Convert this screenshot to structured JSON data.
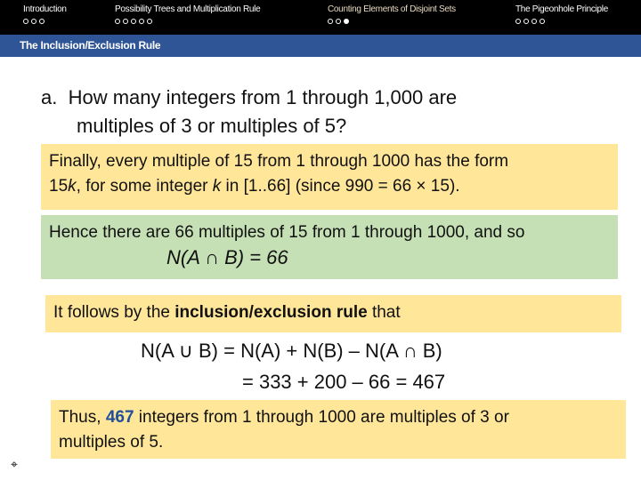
{
  "nav": {
    "sections": [
      {
        "label": "Introduction",
        "dots": 3,
        "filled": -1
      },
      {
        "label": "Possibility Trees and Multiplication Rule",
        "dots": 5,
        "filled": -1
      },
      {
        "label": "Counting Elements of Disjoint Sets",
        "dots": 3,
        "filled": 2,
        "active": true
      },
      {
        "label": "The Pigeonhole Principle",
        "dots": 4,
        "filled": -1
      }
    ]
  },
  "frame_title": "The Inclusion/Exclusion Rule",
  "question": {
    "marker": "a.",
    "line1": "How many integers from 1 through 1,000 are",
    "line2": "multiples of 3 or multiples of 5?"
  },
  "box1": {
    "l1": "Finally, every multiple of 15 from 1 through 1000 has the form",
    "l2a": "15",
    "l2k": "k",
    "l2b": ", for some integer ",
    "l2k2": "k",
    "l2c": " in [1..66] (since 990 = 66 × 15)."
  },
  "box2": {
    "l1": "Hence there are 66 multiples of 15 from 1 through 1000, and so",
    "formula": "N(A ∩ B) = 66"
  },
  "box3": {
    "a": "It follows by the ",
    "b": "inclusion/exclusion rule",
    "c": " that"
  },
  "formula": {
    "line1": "N(A ∪ B)  = N(A) + N(B) – N(A ∩ B)",
    "line2": "= 333 + 200 – 66 = 467"
  },
  "box4": {
    "a": "Thus, ",
    "num": "467",
    "b": " integers from 1 through 1000 are multiples of 3 or",
    "l2": "multiples of 5."
  },
  "colors": {
    "header": "#000000",
    "title_bar": "#2f5597",
    "yellow_box": "#ffe699",
    "green_box": "#c5e0b4",
    "highlight": "#1f4e9c"
  }
}
